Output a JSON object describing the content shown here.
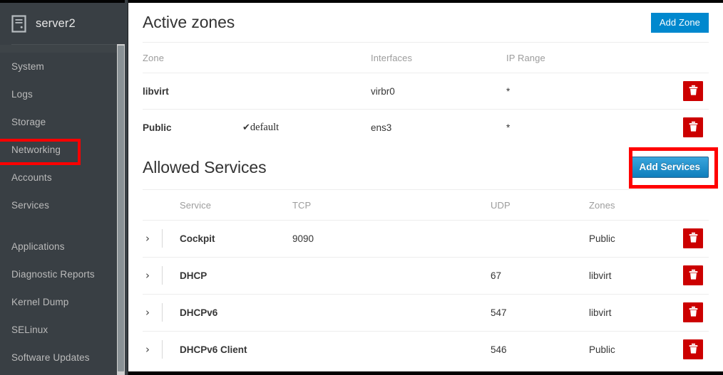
{
  "sidebar": {
    "brand": {
      "name": "server2",
      "icon": "server-icon"
    },
    "items": [
      {
        "label": "System",
        "selected": false
      },
      {
        "label": "Logs",
        "selected": false
      },
      {
        "label": "Storage",
        "selected": false
      },
      {
        "label": "Networking",
        "selected": true
      },
      {
        "label": "Accounts",
        "selected": false
      },
      {
        "label": "Services",
        "selected": false
      },
      {
        "label": "Applications",
        "selected": false
      },
      {
        "label": "Diagnostic Reports",
        "selected": false
      },
      {
        "label": "Kernel Dump",
        "selected": false
      },
      {
        "label": "SELinux",
        "selected": false
      },
      {
        "label": "Software Updates",
        "selected": false
      }
    ]
  },
  "zones": {
    "title": "Active zones",
    "add_button": "Add Zone",
    "columns": [
      "Zone",
      "",
      "Interfaces",
      "IP Range",
      ""
    ],
    "rows": [
      {
        "zone": "libvirt",
        "default": "",
        "default_check": "",
        "interfaces": "virbr0",
        "ip_range": "*",
        "delete_icon": "trash-icon"
      },
      {
        "zone": "Public",
        "default": "default",
        "default_check": "✔",
        "interfaces": "ens3",
        "ip_range": "*",
        "delete_icon": "trash-icon"
      }
    ]
  },
  "services": {
    "title": "Allowed Services",
    "add_button": "Add Services",
    "columns": [
      "",
      "Service",
      "TCP",
      "",
      "UDP",
      "Zones",
      ""
    ],
    "rows": [
      {
        "expander": "›",
        "service": "Cockpit",
        "tcp": "9090",
        "udp": "",
        "zones": "Public",
        "delete_icon": "trash-icon"
      },
      {
        "expander": "›",
        "service": "DHCP",
        "tcp": "",
        "udp": "67",
        "zones": "libvirt",
        "delete_icon": "trash-icon"
      },
      {
        "expander": "›",
        "service": "DHCPv6",
        "tcp": "",
        "udp": "547",
        "zones": "libvirt",
        "delete_icon": "trash-icon"
      },
      {
        "expander": "›",
        "service": "DHCPv6 Client",
        "tcp": "",
        "udp": "546",
        "zones": "Public",
        "delete_icon": "trash-icon"
      }
    ]
  },
  "colors": {
    "sidebar_bg": "#393f44",
    "accent_blue": "#0088ce",
    "danger_red": "#cc0000",
    "highlight_red": "#ff0000"
  }
}
